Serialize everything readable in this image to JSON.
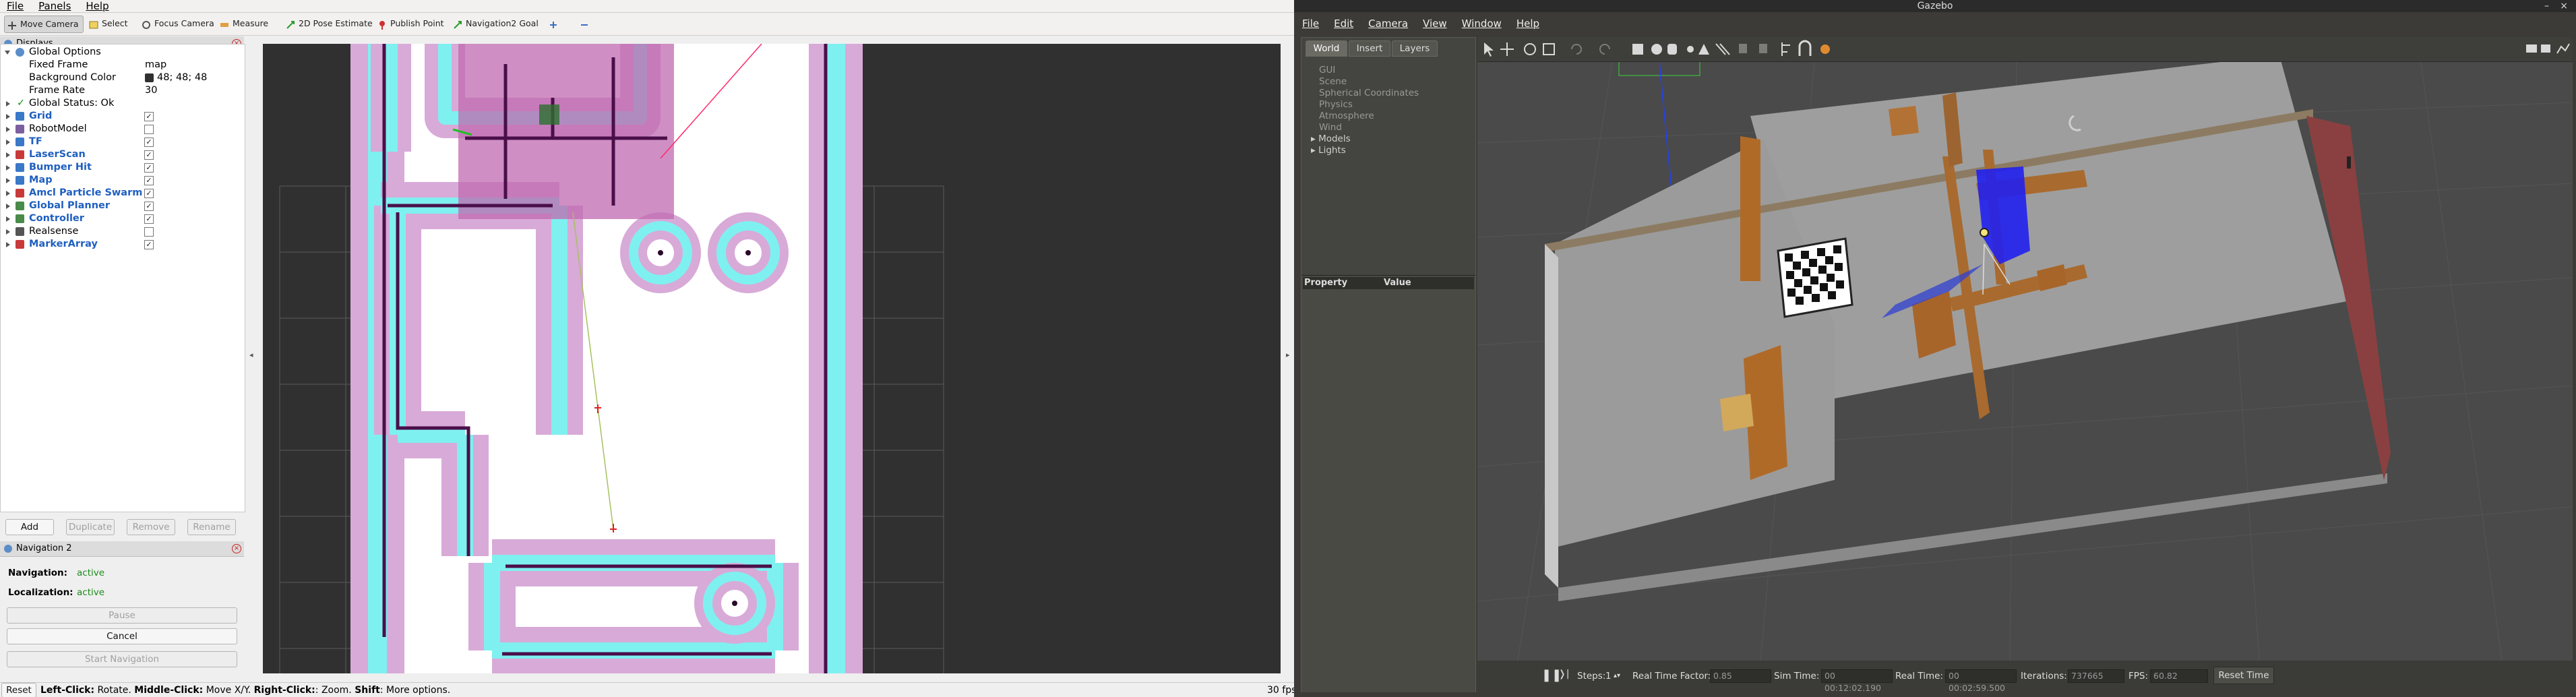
{
  "rviz": {
    "menu": [
      "File",
      "Panels",
      "Help"
    ],
    "tools": [
      {
        "label": "Move Camera",
        "icon": "move-camera-icon"
      },
      {
        "label": "Select",
        "icon": "select-icon"
      },
      {
        "label": "Focus Camera",
        "icon": "focus-camera-icon"
      },
      {
        "label": "Measure",
        "icon": "measure-icon"
      },
      {
        "label": "2D Pose Estimate",
        "icon": "pose-estimate-icon"
      },
      {
        "label": "Publish Point",
        "icon": "publish-point-icon"
      },
      {
        "label": "Navigation2 Goal",
        "icon": "nav-goal-icon"
      }
    ],
    "displays_title": "Displays",
    "global_options": {
      "label": "Global Options",
      "fixed_frame_label": "Fixed Frame",
      "fixed_frame": "map",
      "bg_label": "Background Color",
      "bg_value": "48; 48; 48",
      "frame_rate_label": "Frame Rate",
      "frame_rate": "30"
    },
    "global_status": "Global Status: Ok",
    "displays": [
      {
        "label": "Grid",
        "plugin": true,
        "checked": true,
        "color": "#3a78c8"
      },
      {
        "label": "RobotModel",
        "plugin": false,
        "checked": false,
        "color": "#7b5fa0"
      },
      {
        "label": "TF",
        "plugin": true,
        "checked": true,
        "color": "#3a78c8"
      },
      {
        "label": "LaserScan",
        "plugin": true,
        "checked": true,
        "color": "#c83a3a"
      },
      {
        "label": "Bumper Hit",
        "plugin": true,
        "checked": true,
        "color": "#3a78c8"
      },
      {
        "label": "Map",
        "plugin": true,
        "checked": true,
        "color": "#3a78c8"
      },
      {
        "label": "Amcl Particle Swarm",
        "plugin": true,
        "checked": true,
        "color": "#c83a3a"
      },
      {
        "label": "Global Planner",
        "plugin": true,
        "checked": true,
        "color": "#4a8a4a"
      },
      {
        "label": "Controller",
        "plugin": true,
        "checked": true,
        "color": "#4a8a4a"
      },
      {
        "label": "Realsense",
        "plugin": false,
        "checked": false,
        "color": "#555555"
      },
      {
        "label": "MarkerArray",
        "plugin": true,
        "checked": true,
        "color": "#c83a3a"
      }
    ],
    "buttons": {
      "add": "Add",
      "duplicate": "Duplicate",
      "remove": "Remove",
      "rename": "Rename"
    },
    "nav_title": "Navigation 2",
    "navigation_label": "Navigation:",
    "navigation_value": "active",
    "localization_label": "Localization:",
    "localization_value": "active",
    "pause": "Pause",
    "cancel": "Cancel",
    "start_nav": "Start Navigation",
    "status": {
      "reset": "Reset",
      "hint_parts": [
        "Left-Click:",
        " Rotate. ",
        "Middle-Click:",
        " Move X/Y. ",
        "Right-Click:",
        ": Zoom. ",
        "Shift",
        ": More options."
      ],
      "fps": "30 fps"
    }
  },
  "gazebo": {
    "title": "Gazebo",
    "menu": [
      "File",
      "Edit",
      "Camera",
      "View",
      "Window",
      "Help"
    ],
    "tabs": [
      "World",
      "Insert",
      "Layers"
    ],
    "tree": [
      {
        "label": "GUI",
        "expandable": false
      },
      {
        "label": "Scene",
        "expandable": false
      },
      {
        "label": "Spherical Coordinates",
        "expandable": false
      },
      {
        "label": "Physics",
        "expandable": false
      },
      {
        "label": "Atmosphere",
        "expandable": false
      },
      {
        "label": "Wind",
        "expandable": false
      },
      {
        "label": "Models",
        "expandable": true
      },
      {
        "label": "Lights",
        "expandable": true
      }
    ],
    "property_col": "Property",
    "value_col": "Value",
    "bottom": {
      "steps_label": "Steps:",
      "steps_value": "1",
      "rtf_label": "Real Time Factor:",
      "rtf_value": "0.85",
      "sim_label": "Sim Time:",
      "sim_value": "00 00:12:02.190",
      "real_label": "Real Time:",
      "real_value": "00 00:02:59.500",
      "iter_label": "Iterations:",
      "iter_value": "737665",
      "fps_label": "FPS:",
      "fps_value": "60.82",
      "reset": "Reset Time"
    }
  }
}
